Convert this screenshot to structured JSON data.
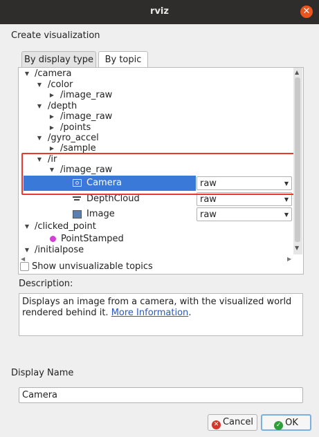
{
  "window": {
    "title": "rviz"
  },
  "dialog": {
    "heading": "Create visualization",
    "tabs": [
      {
        "label": "By display type"
      },
      {
        "label": "By topic"
      }
    ],
    "tree": [
      {
        "label": "/camera"
      },
      {
        "label": "/color"
      },
      {
        "label": "/image_raw"
      },
      {
        "label": "/depth"
      },
      {
        "label": "/image_raw"
      },
      {
        "label": "/points"
      },
      {
        "label": "/gyro_accel"
      },
      {
        "label": "/sample"
      },
      {
        "label": "/ir"
      },
      {
        "label": "/image_raw"
      },
      {
        "label": "Camera",
        "value": "raw",
        "selected": true
      },
      {
        "label": "DepthCloud",
        "value": "raw"
      },
      {
        "label": "Image",
        "value": "raw"
      },
      {
        "label": "/clicked_point"
      },
      {
        "label": "PointStamped"
      },
      {
        "label": "/initialpose"
      }
    ],
    "show_unvisualizable": {
      "label": "Show unvisualizable topics",
      "checked": false
    },
    "description_label": "Description:",
    "description": {
      "text": "Displays an image from a camera, with the visualized world rendered behind it. ",
      "link": "More Information",
      "suffix": "."
    },
    "display_name_label": "Display Name",
    "display_name_value": "Camera",
    "buttons": {
      "cancel": "Cancel",
      "ok": "OK"
    }
  },
  "colors": {
    "selection": "#3b79d8",
    "highlight_box": "#e8392c",
    "title_bar": "#2e2d2b",
    "close": "#e9541f",
    "link": "#2a57c6"
  },
  "icons": [
    "close-icon",
    "camera-icon",
    "depthcloud-icon",
    "image-icon",
    "pointstamped-icon",
    "cancel-icon",
    "ok-check-icon"
  ]
}
